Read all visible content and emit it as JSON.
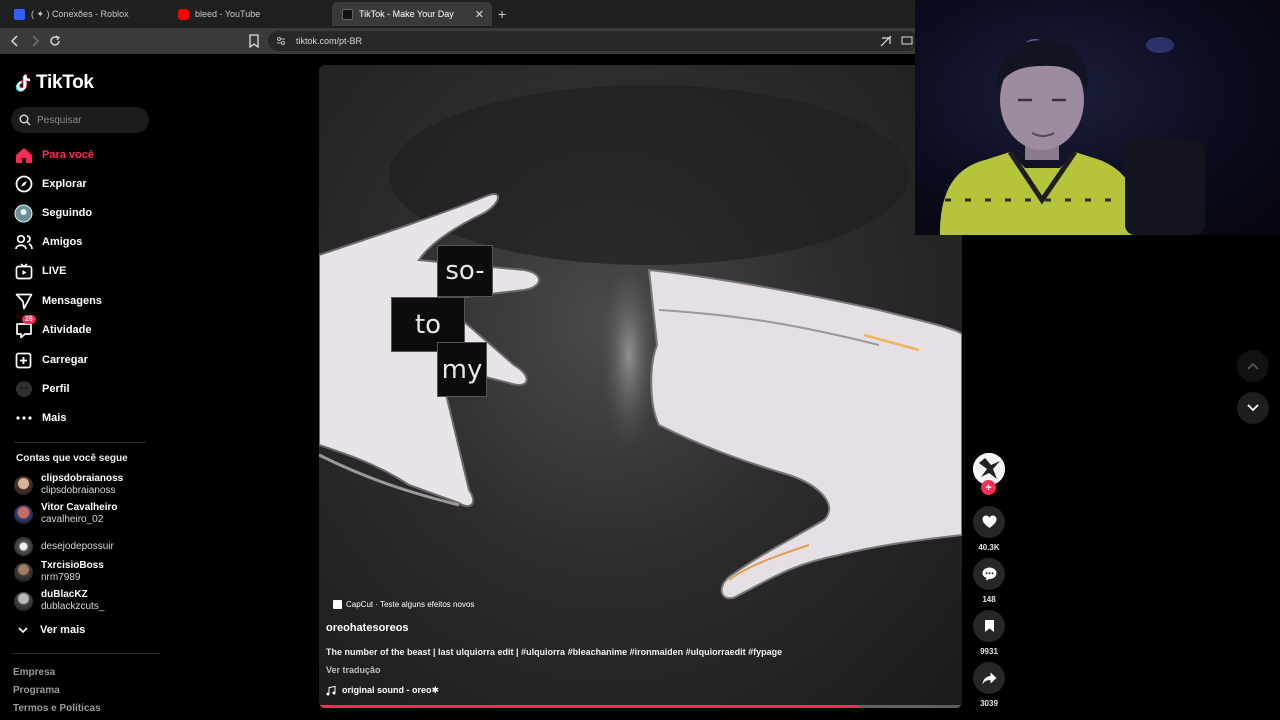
{
  "browser": {
    "tabs": [
      {
        "title": "( ✦ ) Conexões - Roblox",
        "active": false,
        "favicon_color": "#335fff"
      },
      {
        "title": "bleed - YouTube",
        "active": false,
        "favicon_color": "#ff0000"
      },
      {
        "title": "TikTok - Make Your Day",
        "active": true,
        "favicon_color": "#000000"
      }
    ],
    "url": "tiktok.com/pt-BR"
  },
  "sidebar": {
    "logo_text": "TikTok",
    "search_placeholder": "Pesquisar",
    "nav": [
      {
        "label": "Para você",
        "icon": "home-icon",
        "active": true
      },
      {
        "label": "Explorar",
        "icon": "compass-icon"
      },
      {
        "label": "Seguindo",
        "icon": "following-avatar-icon"
      },
      {
        "label": "Amigos",
        "icon": "friends-icon"
      },
      {
        "label": "LIVE",
        "icon": "live-icon"
      },
      {
        "label": "Mensagens",
        "icon": "messages-icon"
      },
      {
        "label": "Atividade",
        "icon": "activity-icon",
        "badge": "26"
      },
      {
        "label": "Carregar",
        "icon": "upload-icon"
      },
      {
        "label": "Perfil",
        "icon": "profile-avatar-icon"
      },
      {
        "label": "Mais",
        "icon": "more-icon"
      }
    ],
    "following_title": "Contas que você segue",
    "accounts": [
      {
        "name": "clipsdobraianoss",
        "username": "clipsdobraianoss"
      },
      {
        "name": "Vitor Cavalheiro",
        "username": "cavalheiro_02"
      },
      {
        "name": "",
        "username": "desejodepossuir"
      },
      {
        "name": "TxrcisioBoss",
        "username": "nrm7989"
      },
      {
        "name": "duBlacKZ",
        "username": "dublackzcuts_"
      }
    ],
    "see_more": "Ver mais",
    "footer": [
      "Empresa",
      "Programa",
      "Termos e Políticas"
    ]
  },
  "video": {
    "lyrics": [
      "so-",
      "to",
      "my"
    ],
    "capcut_label": "CapCut · Teste alguns efeitos novos",
    "author": "oreohatesoreos",
    "caption": "The number of the beast | last ulquiorra edit | #ulquiorra #bleachanime #ironmaiden #ulquiorraedit #fypage",
    "see_translation": "Ver tradução",
    "sound": "original sound - oreo✱",
    "progress": 0.84
  },
  "actions": {
    "likes": "40.3K",
    "comments": "148",
    "saves": "9931",
    "shares": "3039"
  },
  "colors": {
    "accent": "#fe2c55",
    "background": "#000000"
  }
}
